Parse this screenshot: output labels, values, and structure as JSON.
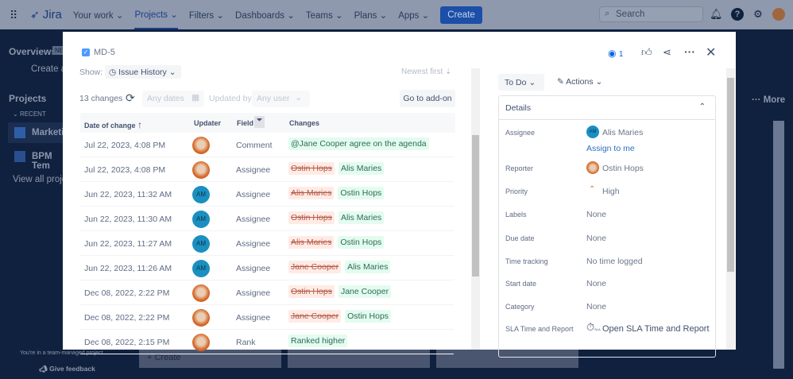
{
  "topnav": {
    "app": "Jira",
    "items": [
      "Your work",
      "Projects",
      "Filters",
      "Dashboards",
      "Teams",
      "Plans",
      "Apps"
    ],
    "create": "Create",
    "search_placeholder": "Search"
  },
  "sidebar": {
    "overviews": "Overviews",
    "new_badge": "NE",
    "create": "Create ar",
    "projects": "Projects",
    "recent": "RECENT",
    "items": [
      "Marketin",
      "BPM Tem"
    ],
    "view_all": "View all project",
    "footer": "You're in a team-managed project",
    "feedback": "Give feedback"
  },
  "background": {
    "more": "More",
    "create": "Create"
  },
  "modal": {
    "issue_key": "MD-5",
    "watchers": "1",
    "show_label": "Show:",
    "show_value": "Issue History",
    "sort_label": "Newest first",
    "changes_count": "13 changes",
    "dates_placeholder": "Any dates",
    "updated_by_label": "Updated by:",
    "user_placeholder": "Any user",
    "goto_addon": "Go to add-on",
    "columns": [
      "Date of change",
      "Updater",
      "Field",
      "Changes"
    ],
    "rows": [
      {
        "date": "Jul 22, 2023, 4:08 PM",
        "updater": "",
        "field": "Comment",
        "old": "",
        "new": "@Jane Cooper agree on the agenda"
      },
      {
        "date": "Jul 22, 2023, 4:08 PM",
        "updater": "",
        "field": "Assignee",
        "old": "Ostin Hops",
        "new": "Alis Maries"
      },
      {
        "date": "Jun 22, 2023, 11:32 AM",
        "updater": "AM",
        "field": "Assignee",
        "old": "Alis Maries",
        "new": "Ostin Hops"
      },
      {
        "date": "Jun 22, 2023, 11:30 AM",
        "updater": "AM",
        "field": "Assignee",
        "old": "Ostin Hops",
        "new": "Alis Maries"
      },
      {
        "date": "Jun 22, 2023, 11:27 AM",
        "updater": "AM",
        "field": "Assignee",
        "old": "Alis Maries",
        "new": "Ostin Hops"
      },
      {
        "date": "Jun 22, 2023, 11:26 AM",
        "updater": "AM",
        "field": "Assignee",
        "old": "Jane Cooper",
        "new": "Alis Maries"
      },
      {
        "date": "Dec 08, 2022, 2:22 PM",
        "updater": "",
        "field": "Assignee",
        "old": "Ostin Hops",
        "new": "Jane Cooper"
      },
      {
        "date": "Dec 08, 2022, 2:22 PM",
        "updater": "",
        "field": "Assignee",
        "old": "Jane Cooper",
        "new": "Ostin Hops"
      },
      {
        "date": "Dec 08, 2022, 2:15 PM",
        "updater": "",
        "field": "Rank",
        "old": "",
        "new": "Ranked higher"
      }
    ],
    "status": "To Do",
    "actions": "Actions",
    "details": "Details",
    "fields": [
      {
        "label": "Assignee",
        "value": "Alis Maries",
        "avatar": "AM"
      },
      {
        "label": "Reporter",
        "value": "Ostin Hops"
      },
      {
        "label": "Priority",
        "value": "High"
      },
      {
        "label": "Labels",
        "value": "None"
      },
      {
        "label": "Due date",
        "value": "None"
      },
      {
        "label": "Time tracking",
        "value": "No time logged"
      },
      {
        "label": "Start date",
        "value": "None"
      },
      {
        "label": "Category",
        "value": "None"
      },
      {
        "label": "SLA Time and Report",
        "value": "Open SLA Time and Report",
        "icon_text": "SLA"
      }
    ],
    "assign_to_me": "Assign to me"
  }
}
